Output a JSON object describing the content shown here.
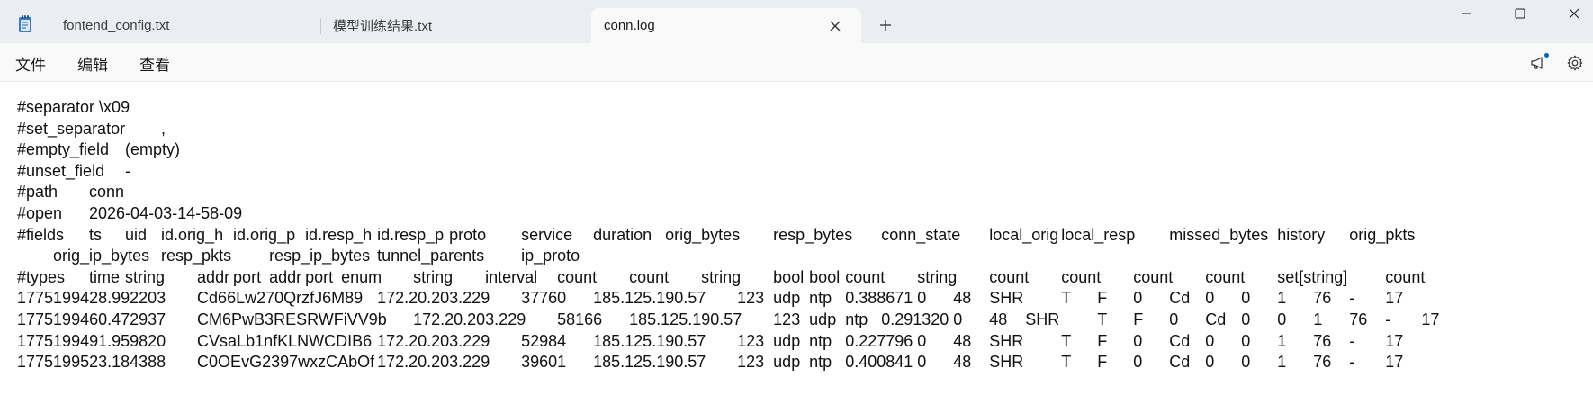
{
  "tabs": [
    {
      "label": "fontend_config.txt",
      "active": false
    },
    {
      "label": "模型训练结果.txt",
      "active": false
    },
    {
      "label": "conn.log",
      "active": true
    }
  ],
  "tab_close_symbol": "×",
  "new_tab_symbol": "+",
  "menu": {
    "file": "文件",
    "edit": "编辑",
    "view": "查看"
  },
  "icons": {
    "app": "notepad-icon",
    "close": "close-icon",
    "new_tab": "plus-icon",
    "minimize": "minimize-icon",
    "maximize": "maximize-icon",
    "window_close": "window-close-icon",
    "announce": "megaphone-icon",
    "settings": "gear-icon"
  },
  "colors": {
    "titlebar": "#eaeef2",
    "active_tab": "#f9f9f9",
    "notify_dot": "#0067c0"
  },
  "document": {
    "lines": [
      "#separator \\x09",
      "#set_separator\t,",
      "#empty_field\t(empty)",
      "#unset_field\t-",
      "#path\tconn",
      "#open\t2026-04-03-14-58-09",
      "#fields\tts\tuid\tid.orig_h\tid.orig_p\tid.resp_h\tid.resp_p\tproto\tservice\tduration\torig_bytes\tresp_bytes\tconn_state\tlocal_orig\tlocal_resp\tmissed_bytes\thistory\torig_pkts",
      "\torig_ip_bytes\tresp_pkts\tresp_ip_bytes\ttunnel_parents\tip_proto",
      "#types\ttime\tstring\taddr\tport\taddr\tport\tenum\tstring\tinterval\tcount\tcount\tstring\tbool\tbool\tcount\tstring\tcount\tcount\tcount\tcount\tset[string]\tcount",
      "1775199428.992203\tCd66Lw270QrzfJ6M89\t172.20.203.229\t37760\t185.125.190.57\t123\tudp\tntp\t0.388671\t0\t48\tSHR\tT\tF\t0\tCd\t0\t0\t1\t76\t-\t17",
      "1775199460.472937\tCM6PwB3RESRWFiVV9b\t172.20.203.229\t58166\t185.125.190.57\t123\tudp\tntp\t0.291320\t0\t48\tSHR\tT\tF\t0\tCd\t0\t0\t1\t76\t-\t17",
      "1775199491.959820\tCVsaLb1nfKLNWCDIB6\t172.20.203.229\t52984\t185.125.190.57\t123\tudp\tntp\t0.227796\t0\t48\tSHR\tT\tF\t0\tCd\t0\t0\t1\t76\t-\t17",
      "1775199523.184388\tC0OEvG2397wxzCAbOf\t172.20.203.229\t39601\t185.125.190.57\t123\tudp\tntp\t0.400841\t0\t48\tSHR\tT\tF\t0\tCd\t0\t0\t1\t76\t-\t17"
    ]
  }
}
